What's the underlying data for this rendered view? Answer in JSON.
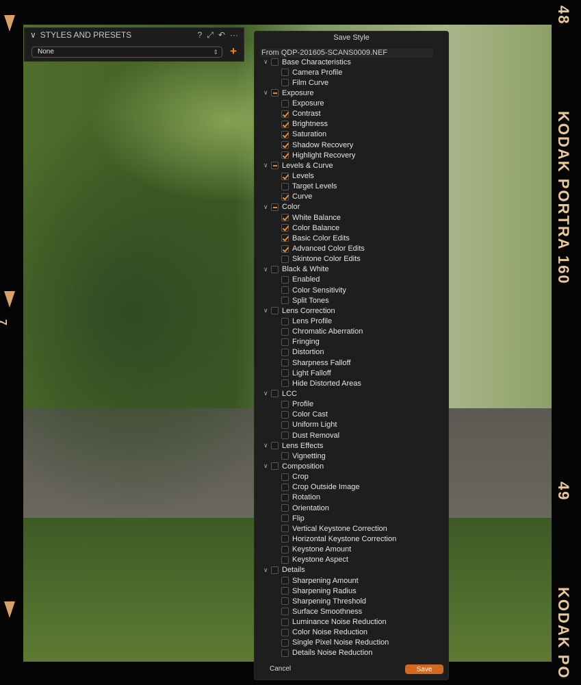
{
  "film": {
    "frame_top": "48",
    "frame_bottom": "49",
    "brand_top": "KODAK PORTRA 160",
    "brand_bottom": "KODAK PO",
    "left_mark": "7"
  },
  "styles_panel": {
    "title": "STYLES AND PRESETS",
    "selected": "None",
    "icons": [
      "help-icon",
      "expand-icon",
      "reset-icon",
      "more-icon"
    ]
  },
  "dialog": {
    "title": "Save Style",
    "from": "From QDP-201605-SCANS0009.NEF",
    "cancel": "Cancel",
    "save": "Save",
    "accent": "#f08a24",
    "groups": [
      {
        "label": "Base Characteristics",
        "state": "off",
        "items": [
          [
            "Camera Profile",
            0
          ],
          [
            "Film Curve",
            0
          ]
        ]
      },
      {
        "label": "Exposure",
        "state": "part",
        "items": [
          [
            "Exposure",
            0
          ],
          [
            "Contrast",
            1
          ],
          [
            "Brightness",
            1
          ],
          [
            "Saturation",
            1
          ],
          [
            "Shadow Recovery",
            1
          ],
          [
            "Highlight Recovery",
            1
          ]
        ]
      },
      {
        "label": "Levels & Curve",
        "state": "part",
        "items": [
          [
            "Levels",
            1
          ],
          [
            "Target Levels",
            0
          ],
          [
            "Curve",
            1
          ]
        ]
      },
      {
        "label": "Color",
        "state": "part",
        "items": [
          [
            "White Balance",
            1
          ],
          [
            "Color Balance",
            1
          ],
          [
            "Basic Color Edits",
            1
          ],
          [
            "Advanced Color Edits",
            1
          ],
          [
            "Skintone Color Edits",
            0
          ]
        ]
      },
      {
        "label": "Black & White",
        "state": "off",
        "items": [
          [
            "Enabled",
            0
          ],
          [
            "Color Sensitivity",
            0
          ],
          [
            "Split Tones",
            0
          ]
        ]
      },
      {
        "label": "Lens Correction",
        "state": "off",
        "items": [
          [
            "Lens Profile",
            0
          ],
          [
            "Chromatic Aberration",
            0
          ],
          [
            "Fringing",
            0
          ],
          [
            "Distortion",
            0
          ],
          [
            "Sharpness Falloff",
            0
          ],
          [
            "Light Falloff",
            0
          ],
          [
            "Hide Distorted Areas",
            0
          ]
        ]
      },
      {
        "label": "LCC",
        "state": "off",
        "items": [
          [
            "Profile",
            0
          ],
          [
            "Color Cast",
            0
          ],
          [
            "Uniform Light",
            0
          ],
          [
            "Dust Removal",
            0
          ]
        ]
      },
      {
        "label": "Lens Effects",
        "state": "off",
        "items": [
          [
            "Vignetting",
            0
          ]
        ]
      },
      {
        "label": "Composition",
        "state": "off",
        "items": [
          [
            "Crop",
            0
          ],
          [
            "Crop Outside Image",
            0
          ],
          [
            "Rotation",
            0
          ],
          [
            "Orientation",
            0
          ],
          [
            "Flip",
            0
          ],
          [
            "Vertical Keystone Correction",
            0
          ],
          [
            "Horizontal Keystone Correction",
            0
          ],
          [
            "Keystone Amount",
            0
          ],
          [
            "Keystone Aspect",
            0
          ]
        ]
      },
      {
        "label": "Details",
        "state": "off",
        "items": [
          [
            "Sharpening Amount",
            0
          ],
          [
            "Sharpening Radius",
            0
          ],
          [
            "Sharpening Threshold",
            0
          ],
          [
            "Surface Smoothness",
            0
          ],
          [
            "Luminance Noise Reduction",
            0
          ],
          [
            "Color Noise Reduction",
            0
          ],
          [
            "Single Pixel Noise Reduction",
            0
          ],
          [
            "Details Noise Reduction",
            0
          ]
        ]
      }
    ]
  }
}
